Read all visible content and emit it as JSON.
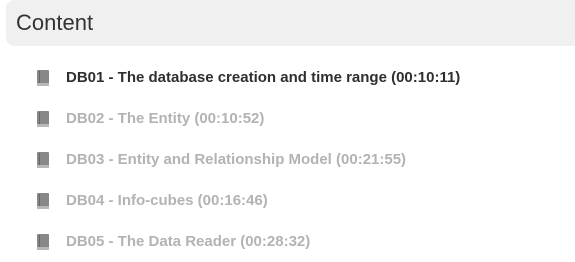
{
  "section": {
    "title": "Content"
  },
  "lessons": [
    {
      "label": "DB01 - The database creation and time range (00:10:11)",
      "state": "active",
      "icon": "book-icon"
    },
    {
      "label": "DB02 - The Entity (00:10:52)",
      "state": "inactive",
      "icon": "book-icon"
    },
    {
      "label": "DB03 - Entity and Relationship Model (00:21:55)",
      "state": "inactive",
      "icon": "book-icon"
    },
    {
      "label": "DB04 - Info-cubes (00:16:46)",
      "state": "inactive",
      "icon": "book-icon"
    },
    {
      "label": "DB05 - The Data Reader (00:28:32)",
      "state": "inactive",
      "icon": "book-icon"
    }
  ],
  "colors": {
    "header_background": "#f0f0f0",
    "active_text": "#2f2f2f",
    "inactive_text": "#b3b3b3",
    "icon": "#888888"
  }
}
